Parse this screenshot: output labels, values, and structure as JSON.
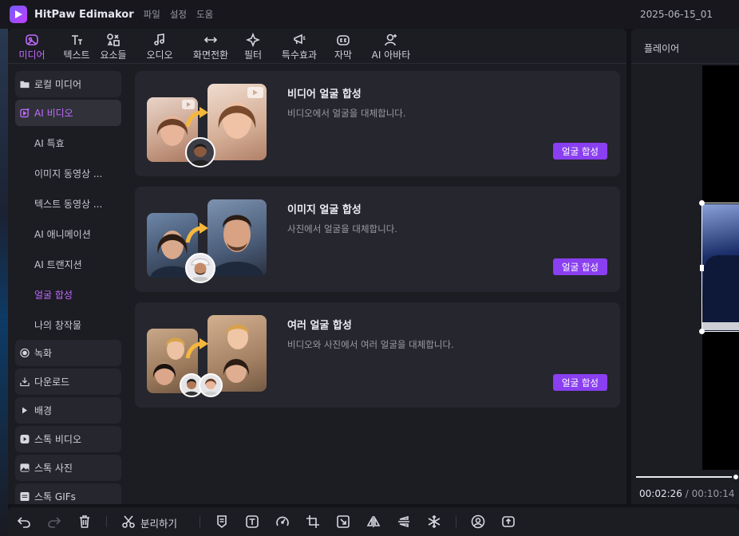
{
  "app": {
    "name": "HitPaw Edimakor",
    "menu": [
      "파일",
      "설정",
      "도움"
    ],
    "project_name": "2025-06-15_01"
  },
  "tabs": [
    {
      "label": "미디어",
      "icon": "media-icon",
      "active": true
    },
    {
      "label": "텍스트",
      "icon": "text-icon"
    },
    {
      "label": "요소들",
      "icon": "elements-icon"
    },
    {
      "label": "오디오",
      "icon": "audio-icon"
    },
    {
      "label": "화면전환",
      "icon": "transition-icon"
    },
    {
      "label": "필터",
      "icon": "filter-icon"
    },
    {
      "label": "특수효과",
      "icon": "effects-icon"
    },
    {
      "label": "자막",
      "icon": "subtitle-icon"
    },
    {
      "label": "AI 아바타",
      "icon": "avatar-icon"
    }
  ],
  "sidebar": {
    "local_media": "로컬 미디어",
    "ai_video": "AI 비디오",
    "sub_items": [
      "AI 특효",
      "이미지 동영상 ...",
      "텍스트 동영상 ...",
      "AI 애니메이션",
      "AI 트랜지션",
      "얼굴 합성",
      "나의 창작물"
    ],
    "recording": "녹화",
    "download": "다운로드",
    "background": "배경",
    "stock_video": "스톡 비디오",
    "stock_photo": "스톡 사진",
    "stock_gifs": "스톡 GIFs"
  },
  "cards": [
    {
      "title": "비디어 얼굴 합성",
      "desc": "비디오에서 얼굴을 대체합니다.",
      "button": "얼굴 합성"
    },
    {
      "title": "이미지 얼굴 합성",
      "desc": "사진에서 얼굴을 대체합니다.",
      "button": "얼굴 합성"
    },
    {
      "title": "여러 얼굴 합성",
      "desc": "비디오와 사진에서 여러 얼굴을 대체합니다.",
      "button": "얼굴 합성"
    }
  ],
  "player": {
    "title": "플레이어",
    "current_time": "00:02:26",
    "separator": " / ",
    "total_time": "00:10:14"
  },
  "toolbar": {
    "split_label": "분리하기"
  },
  "colors": {
    "accent": "#c06bff",
    "button": "#8a3ff0",
    "panel": "#1c1c23",
    "card": "#26262e"
  }
}
